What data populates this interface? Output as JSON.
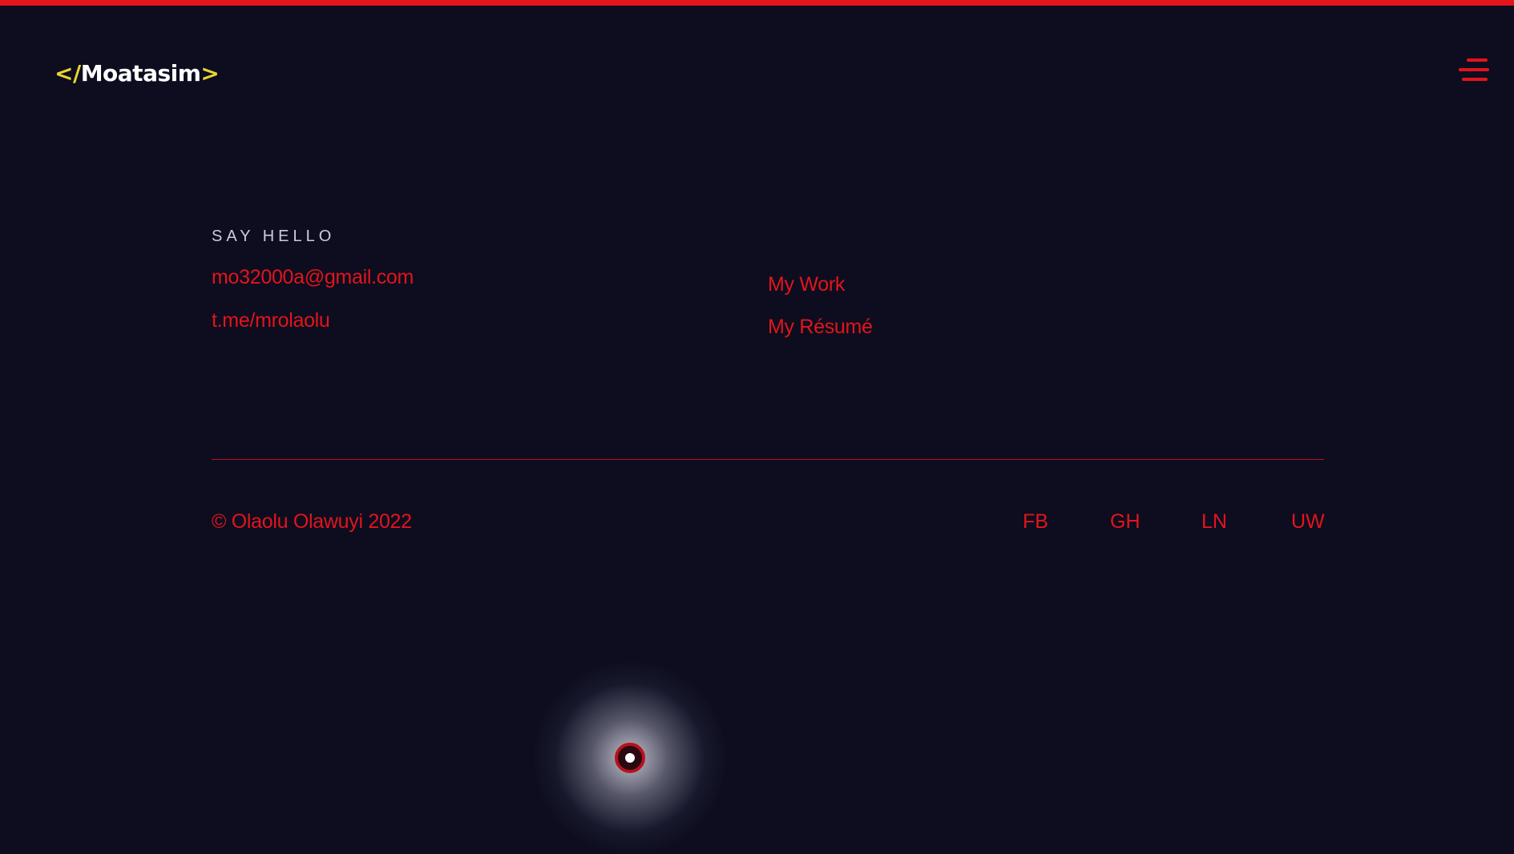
{
  "header": {
    "logo": {
      "open_bracket": "</",
      "name": "Moatasim",
      "close_bracket": ">"
    },
    "menu_icon": "hamburger-menu-icon"
  },
  "contact": {
    "heading": "SAY HELLO",
    "email": "mo32000a@gmail.com",
    "telegram": "t.me/mrolaolu"
  },
  "nav_links": {
    "work": "My Work",
    "resume": "My Résumé"
  },
  "footer": {
    "copyright": "© Olaolu Olawuyi 2022",
    "social": {
      "fb": "FB",
      "gh": "GH",
      "ln": "LN",
      "uw": "UW"
    }
  },
  "colors": {
    "background": "#0d0d1f",
    "accent": "#e3141c",
    "logo_bracket": "#e8d630",
    "heading_text": "#c9cbe0"
  }
}
